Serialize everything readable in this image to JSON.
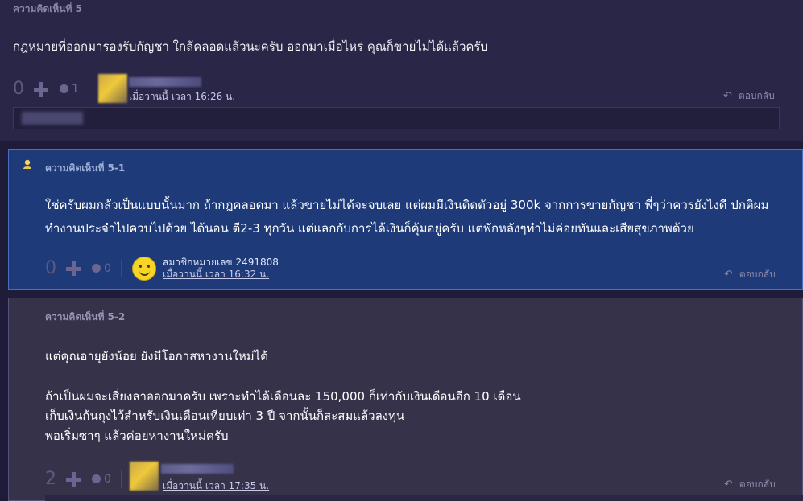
{
  "comment5": {
    "label": "ความคิดเห็นที่ 5",
    "text": "กฎหมายที่ออกมารองรับกัญชา ใกล้คลอดแล้วนะครับ ออกมาเมื่อไหร่ คุณก็ขายไม่ได้แล้วครับ",
    "vote_count": "0",
    "emotion_count": "1",
    "time": "เมื่อวานนี้ เวลา 16:26 น.",
    "reply_label": "ตอบกลับ"
  },
  "comment5_1": {
    "label": "ความคิดเห็นที่ 5-1",
    "text_line1": "ใช่ครับผมกลัวเป็นแบบนั้นมาก ถ้ากฎคลอดมา แล้วขายไม่ได้จะจบเลย แต่ผมมีเงินติดตัวอยู่ 300k จากการขายกัญชา พี่ๆว่าควรยังไงดี ปกติผม",
    "text_line2": "ทำงานประจำไปควบไปด้วย ได้นอน ตี2-3 ทุกวัน แต่แลกกับการได้เงินก็คุ้มอยู่ครับ แต่พักหลังๆทำไม่ค่อยทันและเสียสุขภาพด้วย",
    "vote_count": "0",
    "emotion_count": "0",
    "member": "สมาชิกหมายเลข 2491808",
    "time": "เมื่อวานนี้ เวลา 16:32 น.",
    "reply_label": "ตอบกลับ"
  },
  "comment5_2": {
    "label": "ความคิดเห็นที่ 5-2",
    "lines": [
      "แต่คุณอายุยังน้อย ยังมีโอกาสหางานใหม่ได้",
      "ถ้าเป็นผมจะเสี่ยงลาออกมาครับ เพราะทำได้เดือนละ 150,000  ก็เท่ากับเงินเดือนอีก 10 เดือน",
      "เก็บเงินก้นถุงไว้สำหรับเงินเดือนเทียบเท่า 3 ปี  จากนั้นก็สะสมแล้วลงทุน",
      "พอเริ่มซาๆ แล้วค่อยหางานใหม่ครับ"
    ],
    "vote_count": "2",
    "emotion_count": "0",
    "time": "เมื่อวานนี้ เวลา 17:35 น.",
    "reply_label": "ตอบกลับ"
  },
  "colors": {
    "page_bg": "#1f1c3a",
    "comment_bg": "#2a2647",
    "reply_bg": "#1e3a78",
    "nested_bg": "#35324a"
  },
  "icons": [
    "plus-icon",
    "emotion-icon",
    "reply-arrow-icon",
    "smiley-avatar-icon",
    "member-icon"
  ]
}
